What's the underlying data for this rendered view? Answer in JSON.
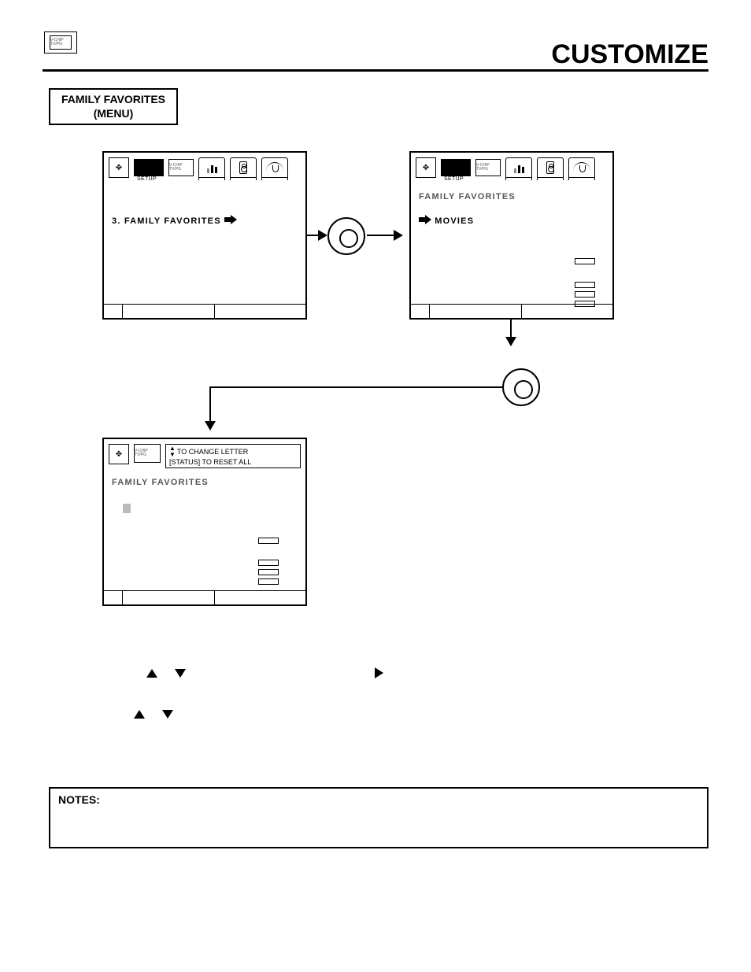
{
  "header": {
    "title": "CUSTOMIZE",
    "logo_label": "V-CHIP TV/PG"
  },
  "menu_box": {
    "line1": "FAMILY FAVORITES",
    "line2": "(MENU)"
  },
  "screens": {
    "s1": {
      "setup_label": "SETUP",
      "sel_prefix": "3.",
      "sel_text": "FAMILY FAVORITES"
    },
    "s2": {
      "setup_label": "SETUP",
      "header": "FAMILY FAVORITES",
      "sel_text": "MOVIES"
    },
    "s3": {
      "hint1": "TO CHANGE LETTER",
      "hint2": "[STATUS] TO RESET ALL",
      "header": "FAMILY FAVORITES"
    }
  },
  "notes": {
    "label": "NOTES:"
  }
}
